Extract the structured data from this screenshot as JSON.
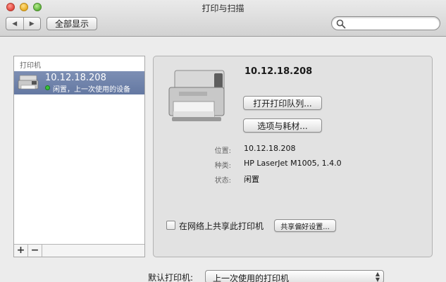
{
  "window": {
    "title": "打印与扫描"
  },
  "toolbar": {
    "back_glyph": "◀",
    "forward_glyph": "▶",
    "show_all_label": "全部显示",
    "search_placeholder": "",
    "search_value": ""
  },
  "printer_list": {
    "header": "打印机",
    "items": [
      {
        "name": "10.12.18.208",
        "status": "闲置，上一次使用的设备",
        "selected": true,
        "status_color": "#38c23b"
      }
    ],
    "add_label": "+",
    "remove_label": "−"
  },
  "detail": {
    "printer_name": "10.12.18.208",
    "open_queue_label": "打开打印队列...",
    "options_label": "选项与耗材...",
    "info": [
      {
        "label": "位置:",
        "value": "10.12.18.208"
      },
      {
        "label": "种类:",
        "value": "HP LaserJet M1005, 1.4.0"
      },
      {
        "label": "状态:",
        "value": "闲置"
      }
    ],
    "share_checkbox_label": "在网络上共享此打印机",
    "share_checked": false,
    "share_prefs_label": "共享偏好设置..."
  },
  "default_printer": {
    "label": "默认打印机:",
    "value": "上一次使用的打印机"
  },
  "colors": {
    "selection": "#6a7ea8",
    "status_idle": "#38c23b"
  }
}
